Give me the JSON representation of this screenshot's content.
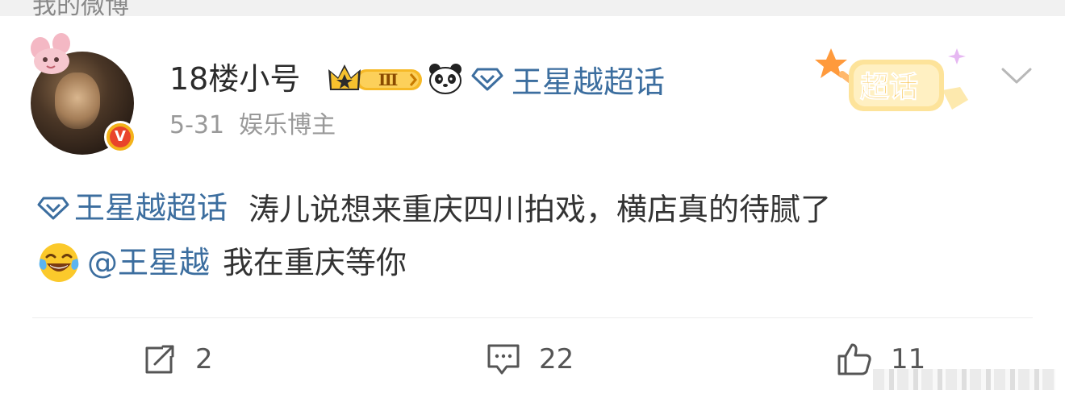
{
  "top_bar": {
    "text": "我的微博"
  },
  "post": {
    "author": {
      "name": "18楼小号",
      "verified_badge": "V",
      "level_badge": "Ⅲ",
      "icons": [
        "avatar-decoration-icon",
        "crown-level-badge-icon",
        "panda-icon"
      ]
    },
    "header_topic": "王星越超话",
    "date": "5-31",
    "source": "娱乐博主",
    "chaohua_badge": "超话",
    "body": {
      "topic": "王星越超话",
      "text_1": "涛儿说想来重庆四川拍戏，横店真的待腻了",
      "mention": "@王星越",
      "text_2": "我在重庆等你",
      "emoji": "laughing-tears-emoji"
    },
    "actions": {
      "repost_count": "2",
      "comment_count": "22",
      "like_count": "11"
    }
  },
  "colors": {
    "link": "#3c6e9f",
    "text": "#333333",
    "meta": "#999999",
    "verified": "#f3b31b"
  }
}
